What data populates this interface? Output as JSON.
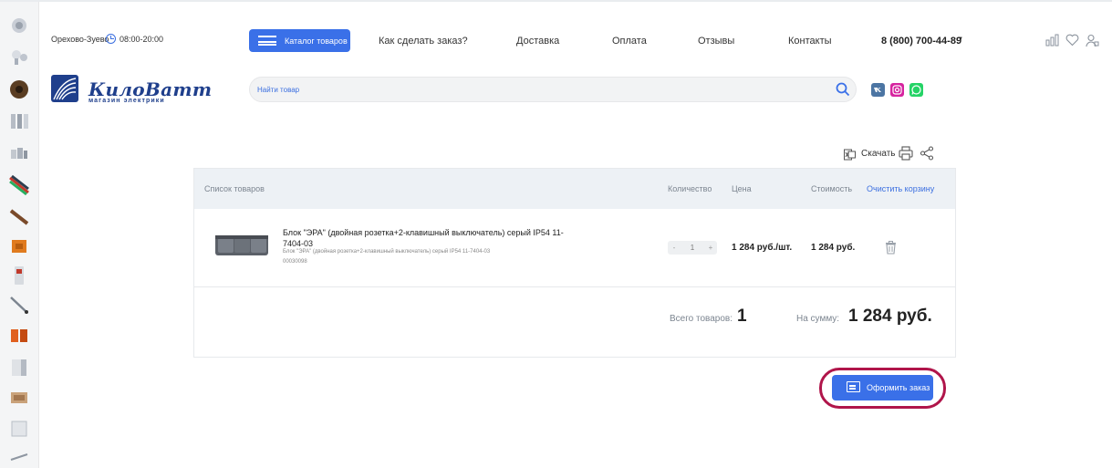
{
  "header": {
    "city": "Орехово-Зуево",
    "hours": "08:00-20:00",
    "catalog_label": "Каталог товаров",
    "nav": [
      {
        "label": "Как сделать заказ?"
      },
      {
        "label": "Доставка"
      },
      {
        "label": "Оплата"
      },
      {
        "label": "Отзывы"
      },
      {
        "label": "Контакты"
      }
    ],
    "phone": "8 (800) 700-44-89",
    "icons": [
      "compare-icon",
      "favorites-icon",
      "account-icon"
    ]
  },
  "logo": {
    "title": "КилоВатт",
    "subtitle": "магазин электрики"
  },
  "search": {
    "placeholder": "Найти товар"
  },
  "social": [
    {
      "name": "vk-icon",
      "color": "#4c75a3"
    },
    {
      "name": "instagram-icon",
      "color": "#d6249f"
    },
    {
      "name": "whatsapp-icon",
      "color": "#25d366"
    }
  ],
  "toolbar": {
    "download_label": "Скачать"
  },
  "cart": {
    "columns": {
      "list": "Список товаров",
      "qty": "Количество",
      "price": "Цена",
      "cost": "Стоимость",
      "clear": "Очистить корзину"
    },
    "items": [
      {
        "name": "Блок \"ЭРА\" (двойная розетка+2-клавишный выключатель) серый IP54 11-7404-03",
        "subtitle": "Блок \"ЭРА\" (двойная розетка+2-клавишный выключатель) серый IP54 11-7404-03",
        "code": "00030098",
        "qty_minus": "-",
        "qty": "1",
        "qty_plus": "+",
        "price": "1 284 руб./шт.",
        "cost": "1 284 руб."
      }
    ],
    "total_items_label": "Всего товаров:",
    "total_items": "1",
    "total_sum_label": "На сумму:",
    "total_sum": "1 284 руб."
  },
  "checkout": {
    "label": "Оформить заказ",
    "accent": "#3a70e8",
    "highlight": "#b0154a"
  },
  "sidebar": {
    "categories": [
      {
        "name": "lamps-category-icon"
      },
      {
        "name": "bulbs-category-icon"
      },
      {
        "name": "cable-category-icon"
      },
      {
        "name": "breakers-category-icon"
      },
      {
        "name": "connectors-category-icon"
      },
      {
        "name": "wires-category-icon"
      },
      {
        "name": "tools-category-icon"
      },
      {
        "name": "boxes-category-icon"
      },
      {
        "name": "meters-category-icon"
      },
      {
        "name": "probe-category-icon"
      },
      {
        "name": "sockets-category-icon"
      },
      {
        "name": "panels-category-icon"
      },
      {
        "name": "heating-category-icon"
      },
      {
        "name": "grilles-category-icon"
      },
      {
        "name": "fasteners-category-icon"
      }
    ]
  }
}
